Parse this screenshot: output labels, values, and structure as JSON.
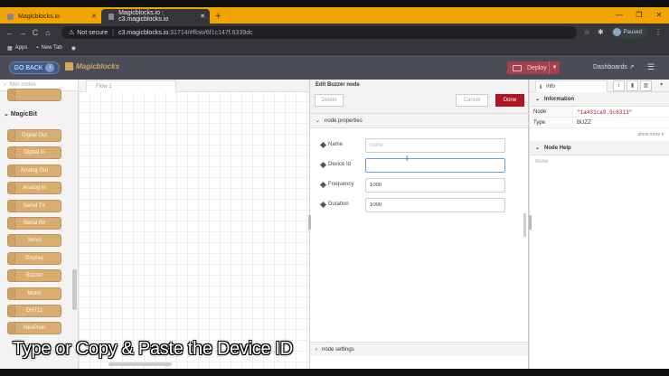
{
  "browser": {
    "tabs": [
      {
        "title": "Magicblocks.io",
        "active": false
      },
      {
        "title": "Magicblocks.io : c3.magicblocks.io",
        "active": true
      }
    ],
    "new_tab": "+",
    "window_controls": [
      "—",
      "❐",
      "✕"
    ],
    "nav": {
      "back": "←",
      "forward": "→",
      "reload": "C",
      "home": "⌂"
    },
    "address": {
      "security": "Not secure",
      "host": "c3.magicblocks.io",
      "path": ":31714/#flow/6f1c147f.6339dc"
    },
    "profile_status": "Paused",
    "bookmarks": [
      "Apps",
      "New Tab"
    ]
  },
  "app": {
    "go_back": "GO BACK",
    "logo": "Magicblocks",
    "deploy": "Deploy",
    "dashboards": "Dashboards"
  },
  "palette": {
    "filter_placeholder": "filter nodes",
    "category": "MagicBit",
    "nodes": [
      "Digital Out",
      "Digital In",
      "Analog Out",
      "Analog In",
      "Serial TX",
      "Serial Rx",
      "Servo",
      "Display",
      "Buzzer",
      "Motor",
      "DHT11",
      "NeoPixel"
    ]
  },
  "workspace": {
    "flow_tab": "Flow 1"
  },
  "editor": {
    "title": "Edit Buzzer node",
    "delete": "Delete",
    "cancel": "Cancel",
    "done": "Done",
    "section_properties": "node properties",
    "fields": {
      "name": {
        "label": "Name",
        "placeholder": "name",
        "value": ""
      },
      "device_id": {
        "label": "Device Id",
        "value": ""
      },
      "frequency": {
        "label": "Frequency",
        "value": "1000"
      },
      "duration": {
        "label": "Duration",
        "value": "1000"
      }
    },
    "section_settings": "node settings"
  },
  "sidebar": {
    "tab": "info",
    "section_information": "Information",
    "rows": [
      {
        "key": "Node",
        "value": "\"1a431ca9.9c6313\""
      },
      {
        "key": "Type",
        "value": "BUZZ"
      }
    ],
    "show_more": "show more",
    "section_help": "Node Help",
    "help_text": "None"
  },
  "caption": "Type or Copy & Paste the Device ID",
  "colors": {
    "accent": "#ad1625",
    "tabbar": "#f0a500",
    "header": "#4a4d57",
    "node": "#d9ad70"
  }
}
